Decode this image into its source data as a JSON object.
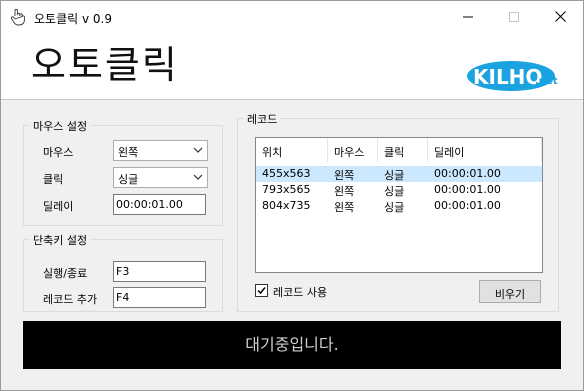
{
  "window": {
    "title": "오토클릭 v 0.9",
    "app_title": "오토클릭",
    "logo_text": "KILHO",
    "logo_suffix": ".net"
  },
  "mouse_settings": {
    "group_label": "마우스 설정",
    "mouse_label": "마우스",
    "mouse_value": "왼쪽",
    "click_label": "클릭",
    "click_value": "싱글",
    "delay_label": "딜레이",
    "delay_value": "00:00:01.00"
  },
  "hotkey_settings": {
    "group_label": "단축키 설정",
    "run_stop_label": "실행/종료",
    "run_stop_value": "F3",
    "add_record_label": "레코드 추가",
    "add_record_value": "F4"
  },
  "records": {
    "group_label": "레코드",
    "columns": [
      "위치",
      "마우스",
      "클릭",
      "딜레이"
    ],
    "rows": [
      [
        "455x563",
        "왼쪽",
        "싱글",
        "00:00:01.00"
      ],
      [
        "793x565",
        "왼쪽",
        "싱글",
        "00:00:01.00"
      ],
      [
        "804x735",
        "왼쪽",
        "싱글",
        "00:00:01.00"
      ]
    ],
    "use_records_label": "레코드 사용",
    "use_records_checked": true,
    "clear_button": "비우기"
  },
  "status": {
    "text": "대기중입니다."
  }
}
